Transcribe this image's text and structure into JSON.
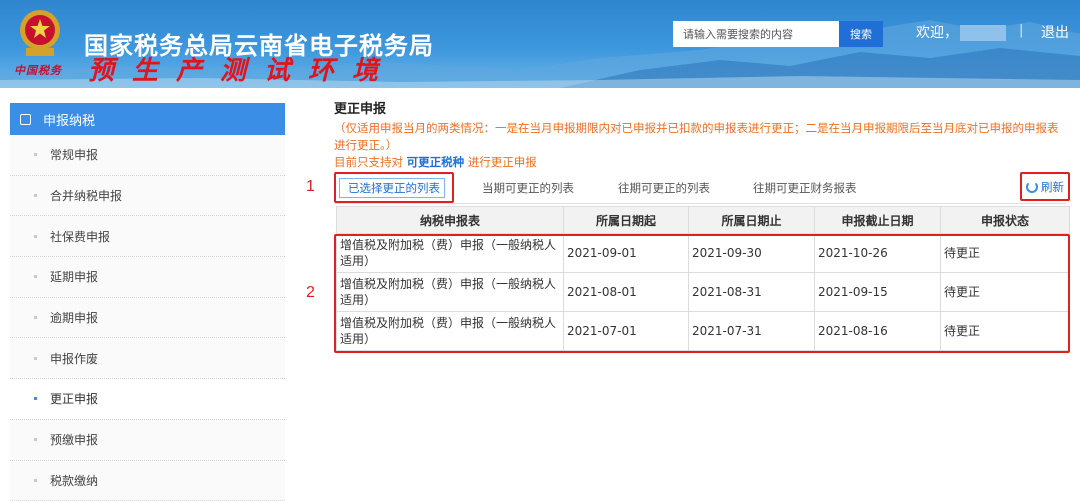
{
  "header": {
    "site_title": "国家税务总局云南省电子税务局",
    "env_title": "预生产测试环境",
    "slogan": "中国税务",
    "search": {
      "placeholder": "请输入需要搜索的内容",
      "button": "搜索"
    },
    "welcome": "欢迎，",
    "separator": "|",
    "logout": "退出"
  },
  "sidebar": {
    "title": "申报纳税",
    "items": [
      {
        "label": "常规申报",
        "active": false
      },
      {
        "label": "合并纳税申报",
        "active": false
      },
      {
        "label": "社保费申报",
        "active": false
      },
      {
        "label": "延期申报",
        "active": false
      },
      {
        "label": "逾期申报",
        "active": false
      },
      {
        "label": "申报作废",
        "active": false
      },
      {
        "label": "更正申报",
        "active": true
      },
      {
        "label": "预缴申报",
        "active": false
      },
      {
        "label": "税款缴纳",
        "active": false
      }
    ]
  },
  "main": {
    "title": "更正申报",
    "note": "（仅适用申报当月的两类情况：一是在当月申报期限内对已申报并已扣款的申报表进行更正；二是在当月申报期限后至当月底对已申报的申报表进行更正。）",
    "support_prefix": "目前只支持对",
    "support_link": "可更正税种",
    "support_suffix": "进行更正申报",
    "tabs": [
      "已选择更正的列表",
      "当期可更正的列表",
      "往期可更正的列表",
      "往期可更正财务报表"
    ],
    "refresh": "刷新",
    "callouts": [
      "1",
      "2"
    ],
    "table": {
      "headers": [
        "纳税申报表",
        "所属日期起",
        "所属日期止",
        "申报截止日期",
        "申报状态"
      ],
      "rows": [
        [
          "增值税及附加税（费）申报（一般纳税人适用）",
          "2021-09-01",
          "2021-09-30",
          "2021-10-26",
          "待更正"
        ],
        [
          "增值税及附加税（费）申报（一般纳税人适用）",
          "2021-08-01",
          "2021-08-31",
          "2021-09-15",
          "待更正"
        ],
        [
          "增值税及附加税（费）申报（一般纳税人适用）",
          "2021-07-01",
          "2021-07-31",
          "2021-08-16",
          "待更正"
        ]
      ]
    }
  },
  "colors": {
    "primary": "#3a8ee6",
    "highlight": "#e02020",
    "note": "#f07020"
  }
}
